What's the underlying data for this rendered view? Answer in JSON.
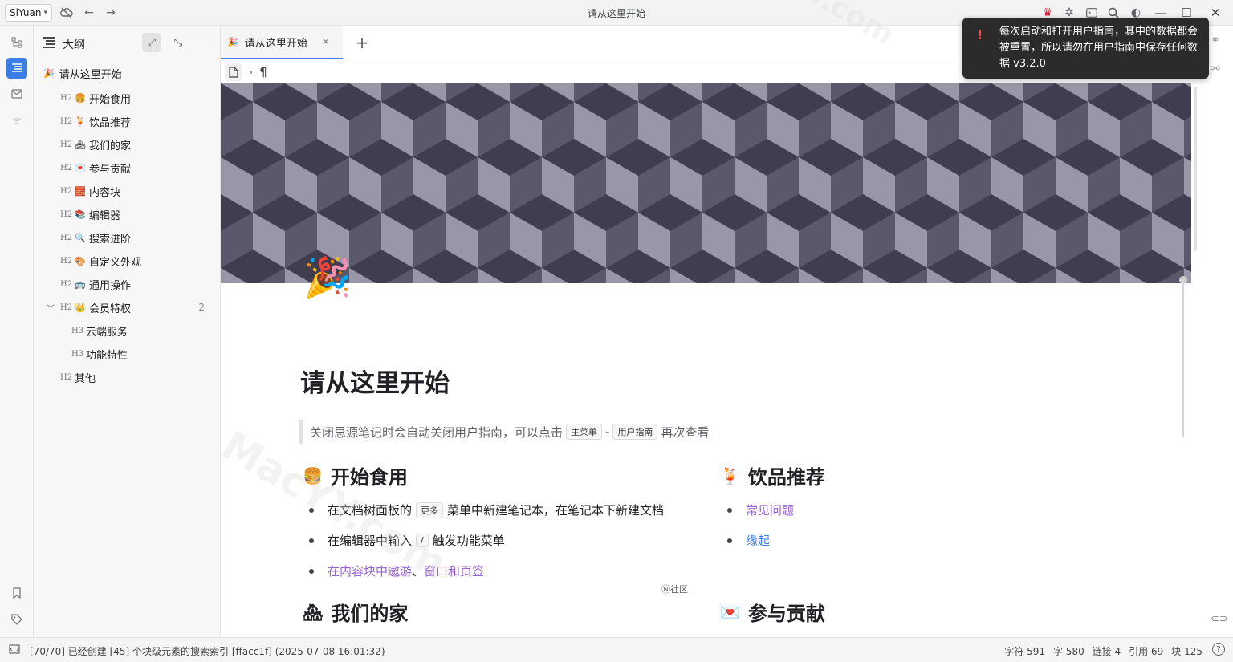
{
  "titlebar": {
    "workspace": "SiYuan",
    "window_title": "请从这里开始"
  },
  "outline": {
    "title": "大纲",
    "doc_name": "请从这里开始",
    "items": [
      {
        "level": "H2",
        "emoji": "🍔",
        "label": "开始食用"
      },
      {
        "level": "H2",
        "emoji": "🍹",
        "label": "饮品推荐"
      },
      {
        "level": "H2",
        "emoji": "🏘",
        "label": "我们的家"
      },
      {
        "level": "H2",
        "emoji": "💌",
        "label": "参与贡献"
      },
      {
        "level": "H2",
        "emoji": "🧱",
        "label": "内容块"
      },
      {
        "level": "H2",
        "emoji": "📚",
        "label": "编辑器"
      },
      {
        "level": "H2",
        "emoji": "🔍",
        "label": "搜索进阶"
      },
      {
        "level": "H2",
        "emoji": "🎨",
        "label": "自定义外观"
      },
      {
        "level": "H2",
        "emoji": "🚌",
        "label": "通用操作"
      },
      {
        "level": "H2",
        "emoji": "👑",
        "label": "会员特权",
        "count": "2"
      },
      {
        "level": "H3",
        "emoji": "",
        "label": "云端服务"
      },
      {
        "level": "H3",
        "emoji": "",
        "label": "功能特性"
      },
      {
        "level": "H2",
        "emoji": "",
        "label": "其他"
      }
    ]
  },
  "tab": {
    "label": "请从这里开始",
    "emoji": "🎉"
  },
  "document": {
    "icon": "🎉",
    "title": "请从这里开始",
    "quote": {
      "text_before": "关闭思源笔记时会自动关闭用户指南，可以点击",
      "kbd1": "主菜单",
      "sep": "-",
      "kbd2": "用户指南",
      "text_after": "再次查看"
    },
    "section1": {
      "emoji": "🍔",
      "heading": "开始食用",
      "li1_before": "在文档树面板的",
      "li1_kbd": "更多",
      "li1_after": "菜单中新建笔记本，在笔记本下新建文档",
      "li2_before": "在编辑器中输入",
      "li2_kbd": "/",
      "li2_after": "触发功能菜单",
      "li3_link1": "在内容块中遨游",
      "li3_sep": "、",
      "li3_link2": "窗口和页签"
    },
    "section2": {
      "emoji": "🍹",
      "heading": "饮品推荐",
      "link1": "常见问题",
      "link2": "缘起"
    },
    "section3": {
      "emoji": "🏘",
      "heading": "我们的家"
    },
    "section4": {
      "emoji": "💌",
      "heading": "参与贡献"
    },
    "community": "Ⓝ社区"
  },
  "toast": {
    "message": "每次启动和打开用户指南，其中的数据都会被重置，所以请勿在用户指南中保存任何数据 v3.2.0"
  },
  "statusbar": {
    "left": "[70/70] 已经创建 [45] 个块级元素的搜索索引 [ffacc1f] (2025-07-08 16:01:32)",
    "chars": "字符 591",
    "words": "字 580",
    "links": "链接 4",
    "refs": "引用 69",
    "blocks": "块 125",
    "help": "?"
  },
  "watermark": "MacYY.com"
}
